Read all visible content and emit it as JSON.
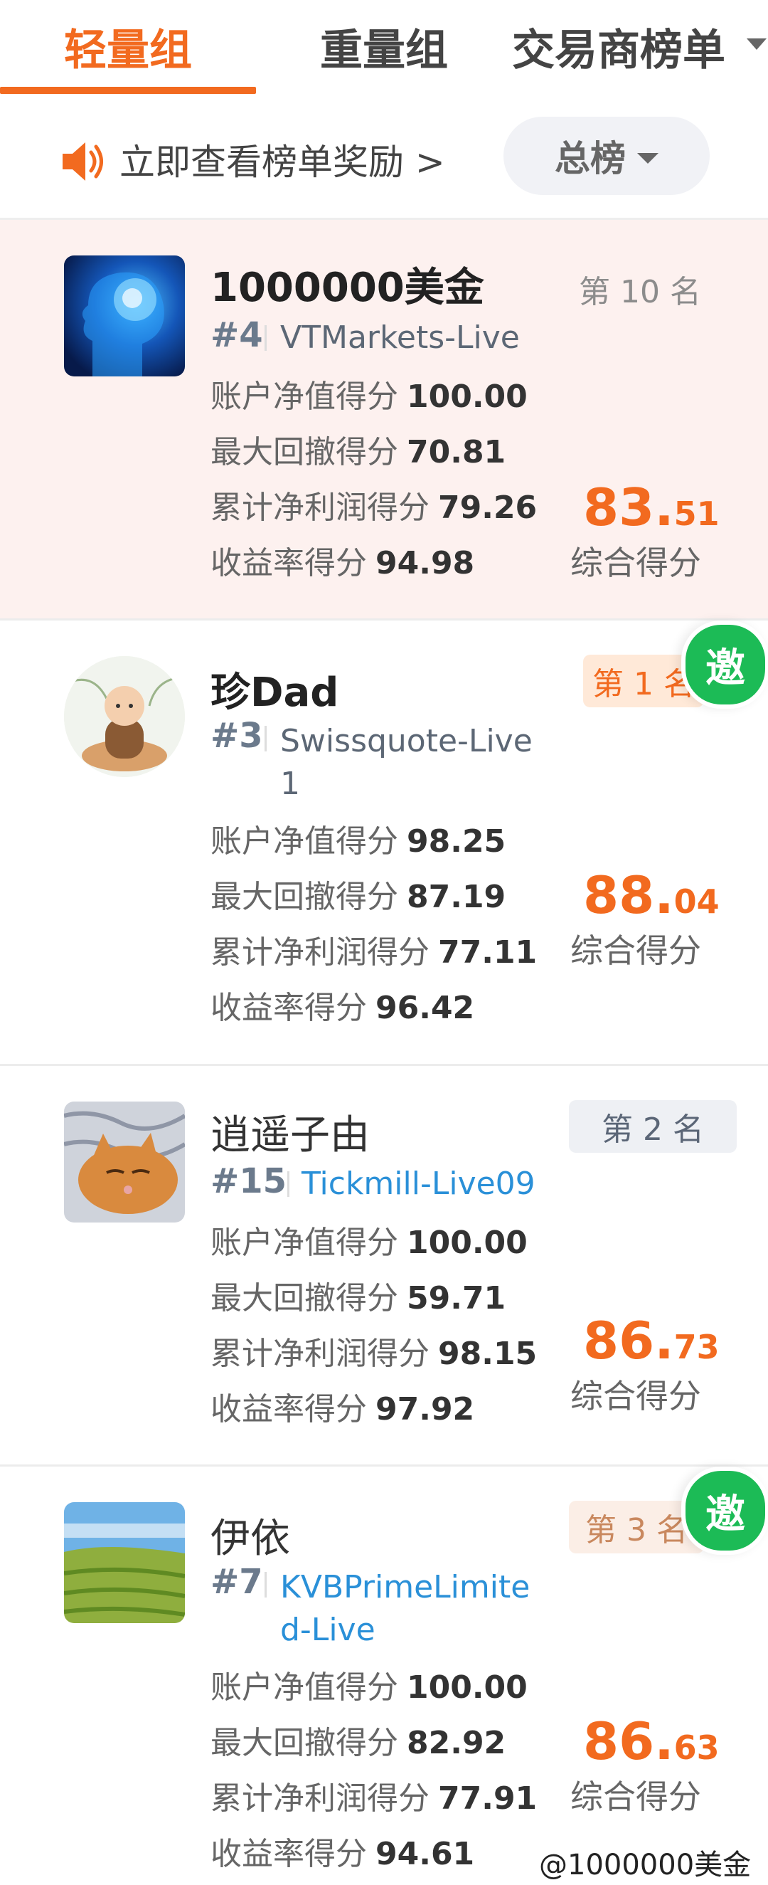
{
  "tabs": [
    {
      "label": "轻量组",
      "active": true
    },
    {
      "label": "重量组",
      "active": false
    },
    {
      "label": "交易商榜单",
      "active": false
    }
  ],
  "notice": {
    "text": "立即查看榜单奖励 >",
    "icon": "speaker-icon"
  },
  "filter": {
    "label": "总榜"
  },
  "colors": {
    "accent": "#f26a1f",
    "invite_green": "#1cbb56",
    "link_blue": "#2a90d8",
    "highlight_bg": "#fdf1ef"
  },
  "cards": [
    {
      "username": "1000000美金",
      "rank_num": "#4",
      "broker": "VTMarkets-Live",
      "place": "第 10 名",
      "metrics": [
        {
          "label": "账户净值得分",
          "value": "100.00"
        },
        {
          "label": "最大回撤得分",
          "value": "70.81"
        },
        {
          "label": "累计净利润得分",
          "value": "79.26"
        },
        {
          "label": "收益率得分",
          "value": "94.98"
        }
      ],
      "score_int": "83",
      "score_dot": ".",
      "score_dec": "51",
      "score_label": "综合得分",
      "avatar_icon": "brain-avatar"
    },
    {
      "username": "珍Dad",
      "rank_num": "#3",
      "broker": "Swissquote-Live",
      "broker_line2": "1",
      "place": "第 1 名",
      "invite": "邀",
      "metrics": [
        {
          "label": "账户净值得分",
          "value": "98.25"
        },
        {
          "label": "最大回撤得分",
          "value": "87.19"
        },
        {
          "label": "累计净利润得分",
          "value": "77.11"
        },
        {
          "label": "收益率得分",
          "value": "96.42"
        }
      ],
      "score_int": "88",
      "score_dot": ".",
      "score_dec": "04",
      "score_label": "综合得分",
      "avatar_icon": "monk-avatar"
    },
    {
      "username": "逍遥子由",
      "rank_num": "#15",
      "broker": "Tickmill-Live09",
      "place": "第 2 名",
      "metrics": [
        {
          "label": "账户净值得分",
          "value": "100.00"
        },
        {
          "label": "最大回撤得分",
          "value": "59.71"
        },
        {
          "label": "累计净利润得分",
          "value": "98.15"
        },
        {
          "label": "收益率得分",
          "value": "97.92"
        }
      ],
      "score_int": "86",
      "score_dot": ".",
      "score_dec": "73",
      "score_label": "综合得分",
      "avatar_icon": "cat-avatar"
    },
    {
      "username": "伊依",
      "rank_num": "#7",
      "broker": "KVBPrimeLimite",
      "broker_line2": "d-Live",
      "place": "第 3 名",
      "invite": "邀",
      "metrics": [
        {
          "label": "账户净值得分",
          "value": "100.00"
        },
        {
          "label": "最大回撤得分",
          "value": "82.92"
        },
        {
          "label": "累计净利润得分",
          "value": "77.91"
        },
        {
          "label": "收益率得分",
          "value": "94.61"
        }
      ],
      "score_int": "86",
      "score_dot": ".",
      "score_dec": "63",
      "score_label": "综合得分",
      "avatar_icon": "landscape-avatar"
    }
  ],
  "watermark": "@1000000美金"
}
